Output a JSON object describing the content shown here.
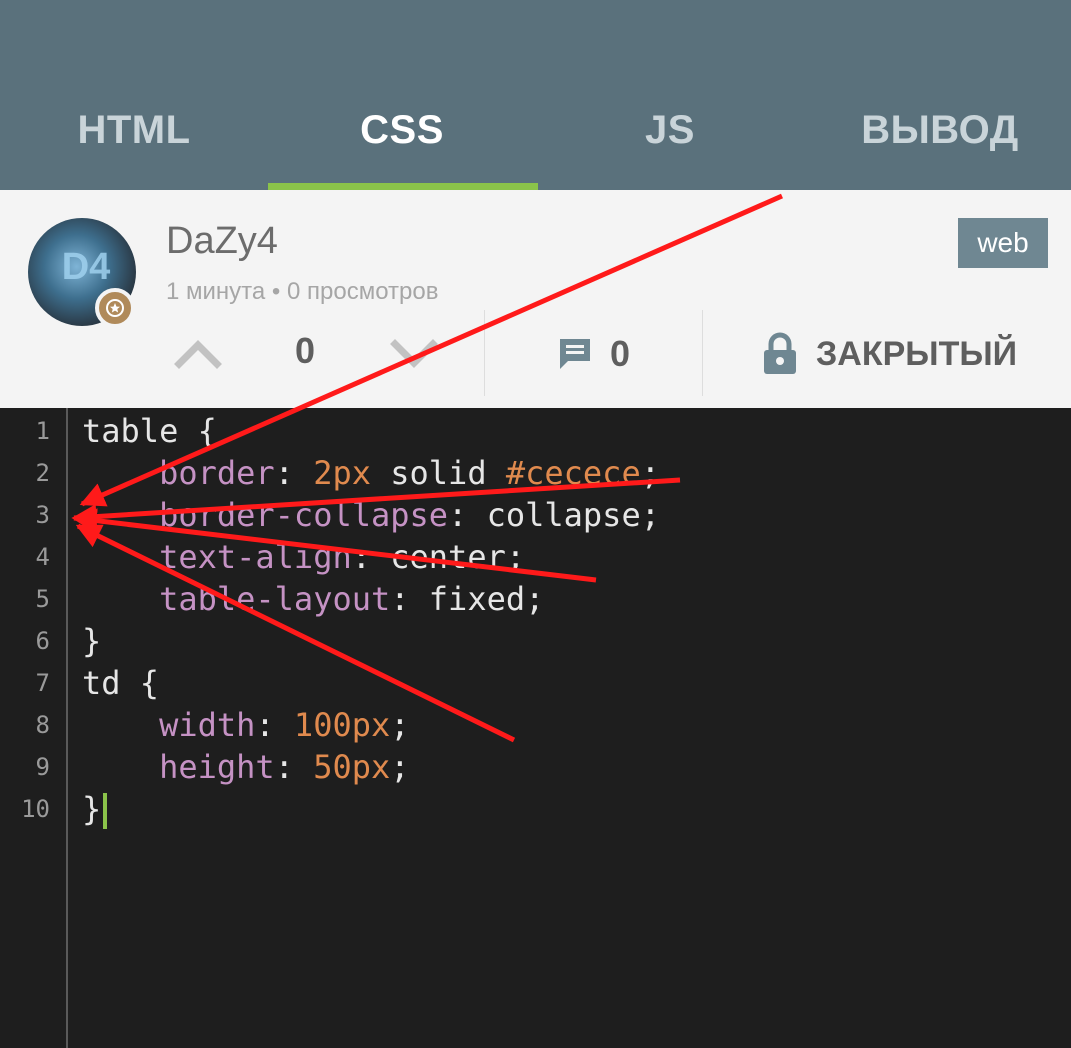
{
  "tabs": [
    {
      "label": "HTML",
      "active": false
    },
    {
      "label": "CSS",
      "active": true
    },
    {
      "label": "JS",
      "active": false
    },
    {
      "label": "ВЫВОД",
      "active": false
    }
  ],
  "post": {
    "username": "DaZy4",
    "avatar_text": "D4",
    "meta": "1 минута • 0 просмотров",
    "tag": "web",
    "votes": "0",
    "comments": "0",
    "status": "ЗАКРЫТЫЙ"
  },
  "editor": {
    "line_numbers": [
      "1",
      "2",
      "3",
      "4",
      "5",
      "6",
      "7",
      "8",
      "9",
      "10"
    ],
    "lines": {
      "l1": {
        "sel": "table",
        "rest": " {"
      },
      "l2": {
        "indent": "    ",
        "prop": "border",
        "colon": ": ",
        "num": "2px",
        "mid": " solid ",
        "hex": "#cecece",
        "end": ";"
      },
      "l3": {
        "indent": "    ",
        "prop": "border-collapse",
        "colon": ": ",
        "val": "collapse",
        "end": ";"
      },
      "l4": {
        "indent": "    ",
        "prop": "text-align",
        "colon": ": ",
        "val": "center",
        "end": ";"
      },
      "l5": {
        "indent": "    ",
        "prop": "table-layout",
        "colon": ": ",
        "val": "fixed",
        "end": ";"
      },
      "l6": {
        "text": "}"
      },
      "l7": {
        "sel": "td",
        "rest": " {"
      },
      "l8": {
        "indent": "    ",
        "prop": "width",
        "colon": ": ",
        "num": "100px",
        "end": ";"
      },
      "l9": {
        "indent": "    ",
        "prop": "height",
        "colon": ": ",
        "num": "50px",
        "end": ";"
      },
      "l10": {
        "text": "}"
      }
    }
  },
  "colors": {
    "appbar": "#5a717c",
    "tab_indicator": "#8bc34a",
    "annotation_arrows": "#ff1a1a",
    "code_property": "#c592c4",
    "code_number": "#e08a4e"
  },
  "icons": {
    "upvote": "chevron-up-icon",
    "downvote": "chevron-down-icon",
    "comments": "comment-icon",
    "closed": "lock-icon",
    "badge": "star-icon"
  }
}
